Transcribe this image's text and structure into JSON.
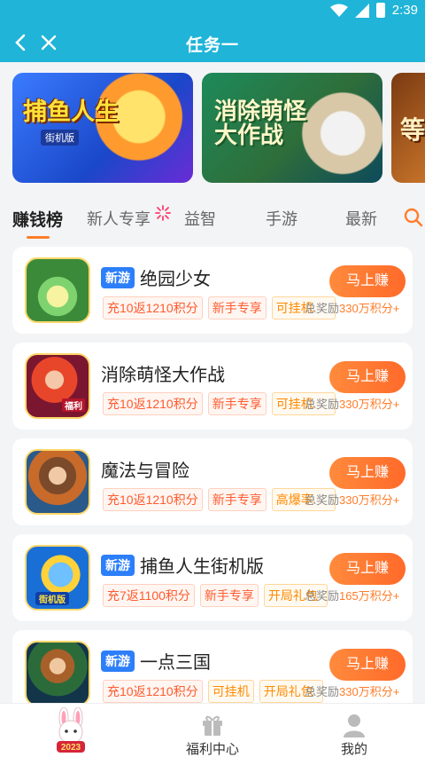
{
  "status": {
    "time": "2:39"
  },
  "header": {
    "title": "任务一"
  },
  "banners": [
    {
      "title": "捕鱼人生",
      "subtitle": "街机版"
    },
    {
      "title": "消除萌怪大作战"
    },
    {
      "title": "等"
    }
  ],
  "tabs": [
    {
      "label": "赚钱榜"
    },
    {
      "label": "新人专享"
    },
    {
      "label": "益智"
    },
    {
      "label": "手游"
    },
    {
      "label": "最新"
    }
  ],
  "games": [
    {
      "badge": "新游",
      "name": "绝园少女",
      "tags": [
        "充10返1210积分",
        "新手专享",
        "可挂机"
      ],
      "button": "马上赚",
      "reward_prefix": "总奖励",
      "reward": "330万积分+"
    },
    {
      "badge": "",
      "name": "消除萌怪大作战",
      "icon_tag": "福利",
      "tags": [
        "充10返1210积分",
        "新手专享",
        "可挂机"
      ],
      "button": "马上赚",
      "reward_prefix": "总奖励",
      "reward": "330万积分+"
    },
    {
      "badge": "",
      "name": "魔法与冒险",
      "tags": [
        "充10返1210积分",
        "新手专享",
        "高爆率"
      ],
      "button": "马上赚",
      "reward_prefix": "总奖励",
      "reward": "330万积分+"
    },
    {
      "badge": "新游",
      "name": "捕鱼人生街机版",
      "icon_tag": "街机版",
      "tags": [
        "充7返1100积分",
        "新手专享",
        "开局礼包"
      ],
      "button": "马上赚",
      "reward_prefix": "总奖励",
      "reward": "165万积分+"
    },
    {
      "badge": "新游",
      "name": "一点三国",
      "tags": [
        "充10返1210积分",
        "可挂机",
        "开局礼包"
      ],
      "button": "马上赚",
      "reward_prefix": "总奖励",
      "reward": "330万积分+"
    }
  ],
  "bottom_nav": {
    "home_badge": "2023",
    "welfare": "福利中心",
    "mine": "我的"
  },
  "colors": {
    "primary": "#1fb4d8",
    "accent": "#ff7d2a",
    "new_badge": "#2d7ff9"
  }
}
